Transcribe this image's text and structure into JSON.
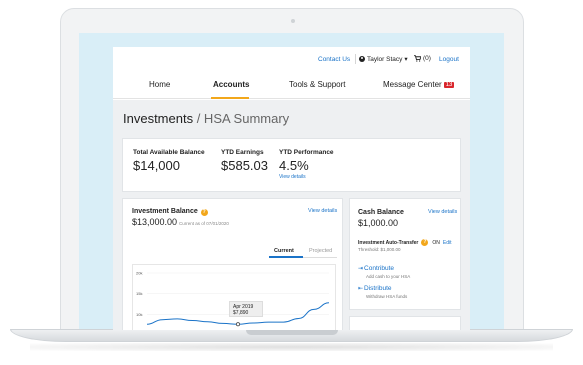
{
  "topbar": {
    "contact_label": "Contact Us",
    "user_name": "Taylor Stacy",
    "user_caret": "▾",
    "cart_label": "(0)",
    "logout_label": "Logout"
  },
  "nav": {
    "items": [
      {
        "label": "Home"
      },
      {
        "label": "Accounts"
      },
      {
        "label": "Tools & Support"
      },
      {
        "label": "Message Center"
      }
    ],
    "message_badge": "13"
  },
  "page": {
    "title": "Investments",
    "subtitle": " / HSA Summary"
  },
  "summary": {
    "total_label": "Total Available Balance",
    "total_value": "$14,000",
    "ytd_earnings_label": "YTD Earnings",
    "ytd_earnings_value": "$585.03",
    "ytd_perf_label": "YTD Performance",
    "ytd_perf_value": "4.5%",
    "view_details": "View details"
  },
  "investment": {
    "title": "Investment Balance",
    "view_details": "View details",
    "balance": "$13,000.00",
    "as_of": "Current as of 07/01/2020",
    "tab_current": "Current",
    "tab_projected": "Projected"
  },
  "chart_data": {
    "type": "line",
    "yticks": [
      "20k",
      "15k",
      "10k",
      "5k"
    ],
    "ylim": [
      5000,
      20000
    ],
    "series": [
      {
        "values": [
          7600,
          8700,
          8900,
          8500,
          8200,
          7800,
          7600,
          7900,
          8100,
          8100,
          9000,
          11200,
          12800
        ]
      }
    ],
    "tooltip": {
      "date": "Apr 2019",
      "value": "$7,890"
    }
  },
  "cash": {
    "title": "Cash Balance",
    "view_details": "View details",
    "balance": "$1,000.00",
    "auto_label": "Investment Auto-Transfer",
    "auto_status": "ON",
    "edit_label": "Edit",
    "threshold": "Threshold: $1,000.00",
    "contribute_label": "Contribute",
    "contribute_desc": "Add cash to your HSA",
    "distribute_label": "Distribute",
    "distribute_desc": "Withdraw HSA funds"
  },
  "colors": {
    "accent": "#1a73c8",
    "highlight": "#f2a71b",
    "badge": "#d9262c",
    "screen_bg": "#d9eef7"
  }
}
